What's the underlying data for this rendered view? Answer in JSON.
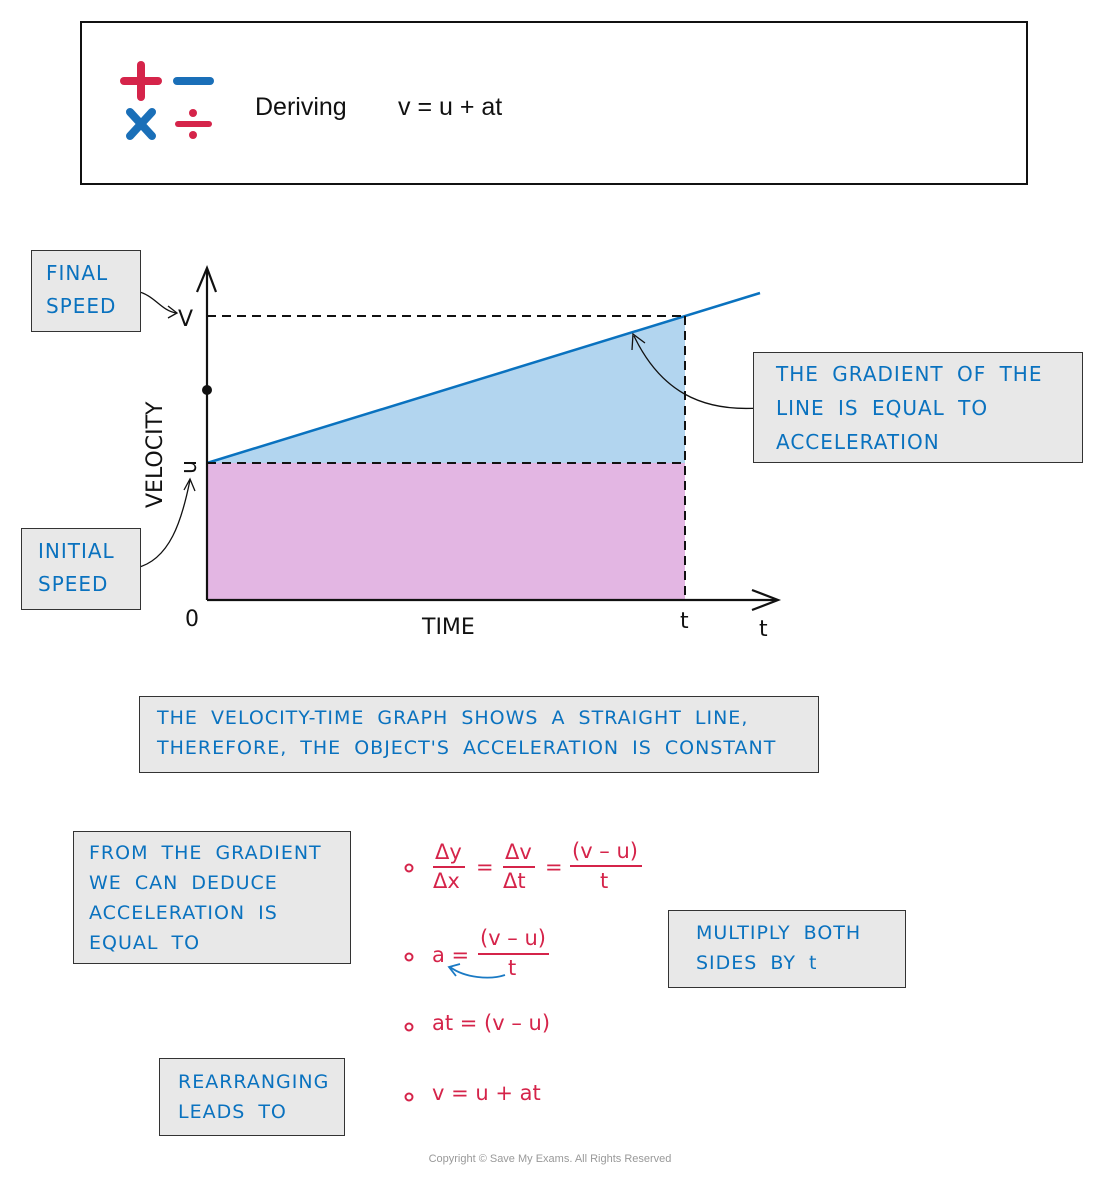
{
  "header": {
    "title": "Deriving",
    "equation": "v = u + at",
    "icon": "math-operators-icon"
  },
  "graph": {
    "y_axis_label": "VELOCITY",
    "x_axis_label": "TIME",
    "v_label": "V",
    "u_label": "u",
    "origin_label": "0",
    "t_tick_label": "t",
    "t_axis_label": "t",
    "colors": {
      "line": "#0a72bf",
      "upper_area": "#b2d5ef",
      "lower_area": "#e3b6e3"
    }
  },
  "notes": {
    "final_speed": [
      "FINAL",
      "SPEED"
    ],
    "initial_speed": [
      "INITIAL",
      "SPEED"
    ],
    "gradient": [
      "THE GRADIENT OF THE",
      "LINE IS EQUAL TO",
      "ACCELERATION"
    ],
    "straight_line": [
      "THE VELOCITY-TIME GRAPH SHOWS A STRAIGHT LINE,",
      "THEREFORE, THE OBJECT'S ACCELERATION IS CONSTANT"
    ],
    "from_gradient": [
      "FROM THE GRADIENT",
      "WE CAN DEDUCE",
      "ACCELERATION IS",
      "EQUAL TO"
    ],
    "multiply": [
      "MULTIPLY BOTH",
      "SIDES BY t"
    ],
    "rearranging": [
      "REARRANGING",
      "LEADS TO"
    ]
  },
  "equations": {
    "step1": {
      "f1n": "Δy",
      "f1d": "Δx",
      "f2n": "Δv",
      "f2d": "Δt",
      "f3n": "(v – u)",
      "f3d": "t",
      "eq": "="
    },
    "step2": {
      "lhs": "a =",
      "num": "(v – u)",
      "den": "t"
    },
    "step3": "at = (v – u)",
    "step4": "v = u + at"
  },
  "copyright": "Copyright © Save My Exams. All Rights Reserved",
  "colors": {
    "note_text": "#0a72bf",
    "equation": "#d5244a",
    "note_bg": "#e8e8e8"
  }
}
